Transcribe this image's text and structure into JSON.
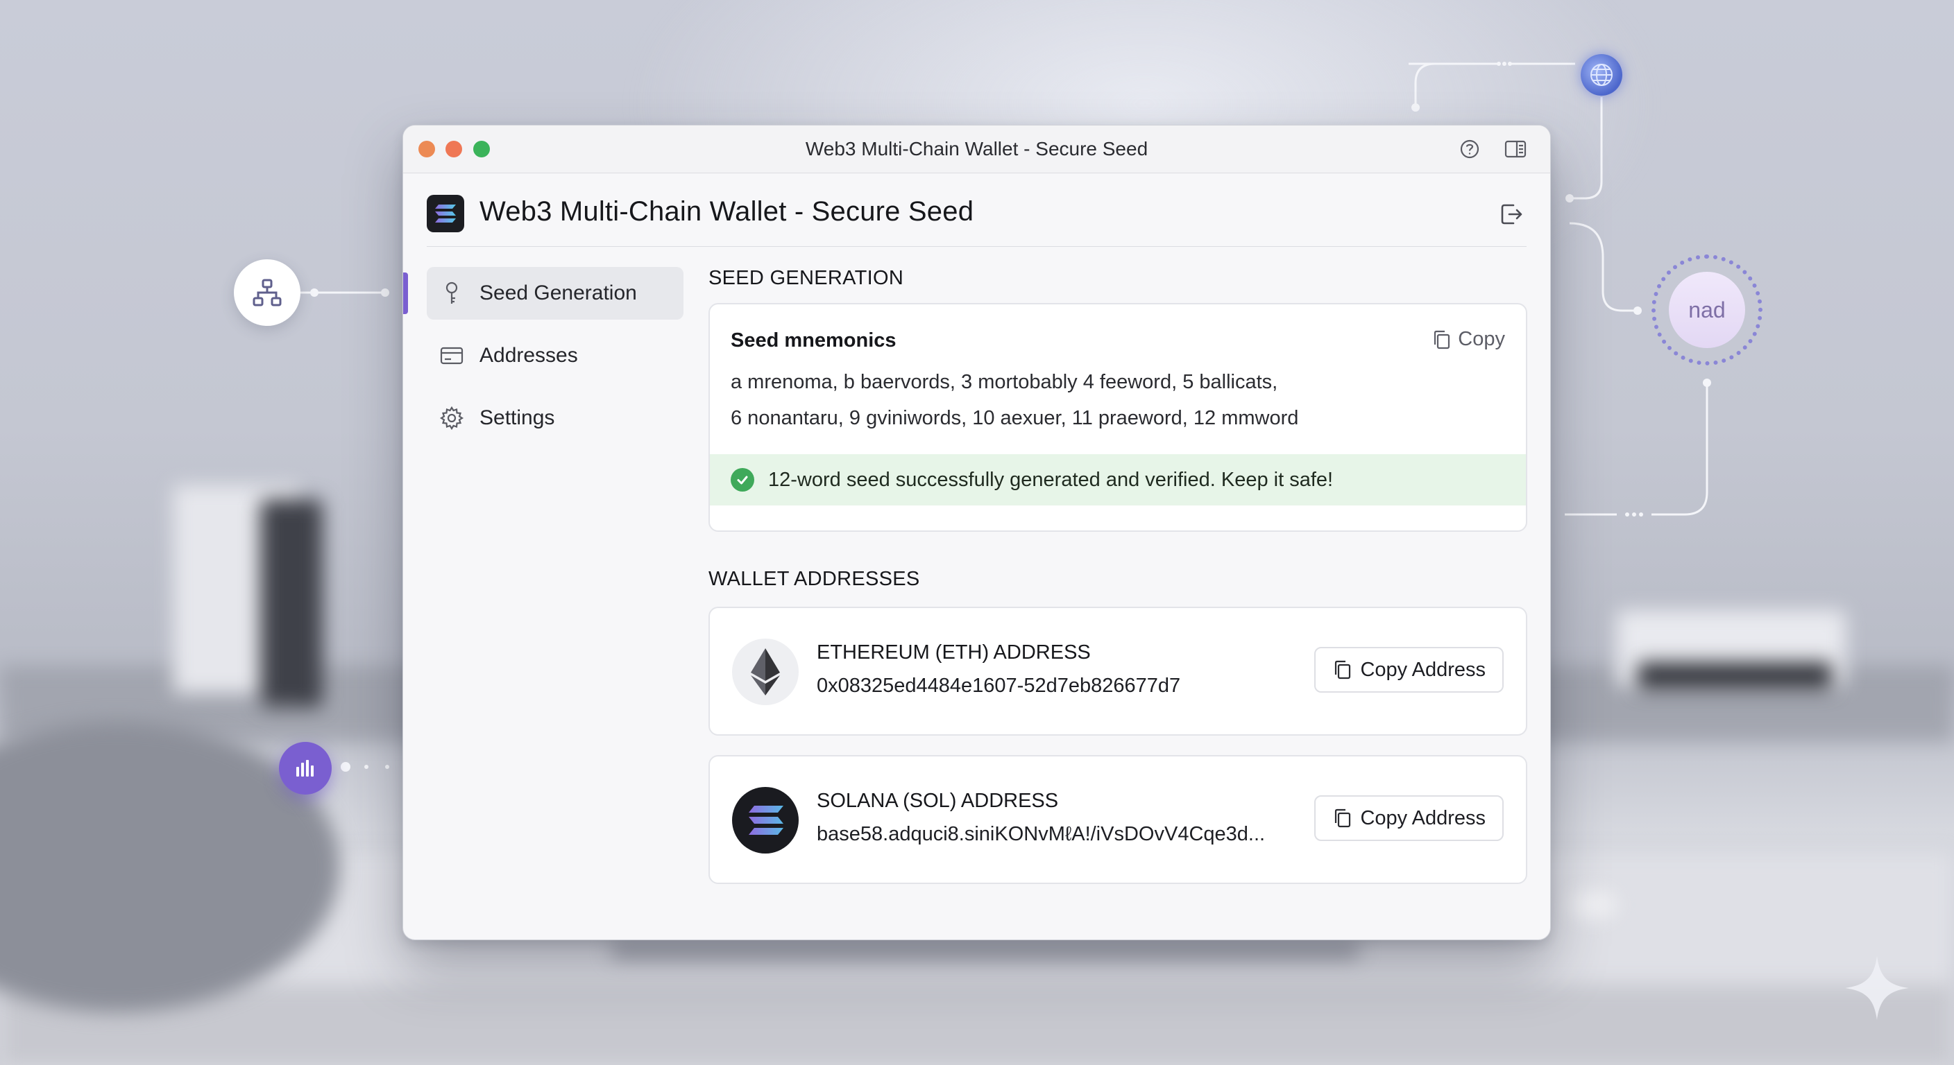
{
  "window": {
    "title": "Web3 Multi-Chain Wallet - Secure Seed"
  },
  "header": {
    "title": "Web3 Multi-Chain Wallet - Secure Seed"
  },
  "sidebar": {
    "items": [
      {
        "label": "Seed Generation",
        "icon": "key-icon",
        "active": true
      },
      {
        "label": "Addresses",
        "icon": "wallet-card-icon",
        "active": false
      },
      {
        "label": "Settings",
        "icon": "gear-icon",
        "active": false
      }
    ]
  },
  "seed": {
    "section_title": "SEED GENERATION",
    "card_label": "Seed mnemonics",
    "copy_label": "Copy",
    "line1": "a mrenoma, b baervords, 3 mortobably  4 feeword, 5 ballicats,",
    "line2": "6 nonantaru, 9 gviniwords, 10 aexuer, 11 praeword, 12 mmword",
    "status": "12-word seed successfully generated and verified. Keep it safe!"
  },
  "addresses": {
    "section_title": "WALLET ADDRESSES",
    "eth": {
      "name": "ETHEREUM (ETH) ADDRESS",
      "value": "0x08325ed4484e1607-52d7eb826677d7",
      "button": "Copy Address"
    },
    "sol": {
      "name": "SOLANA (SOL) ADDRESS",
      "value": "base58.adquci8.siniKONvMℓA!/iVsDOvV4Cqe3d...",
      "button": "Copy Address"
    }
  },
  "decor": {
    "badge_text": "nad"
  },
  "colors": {
    "accent": "#7a5fd0",
    "success_bg": "#e7f5e8",
    "success_icon": "#3fa95a",
    "close": "#ec8a54",
    "minimize": "#ef7755",
    "maximize": "#3bb35a"
  }
}
